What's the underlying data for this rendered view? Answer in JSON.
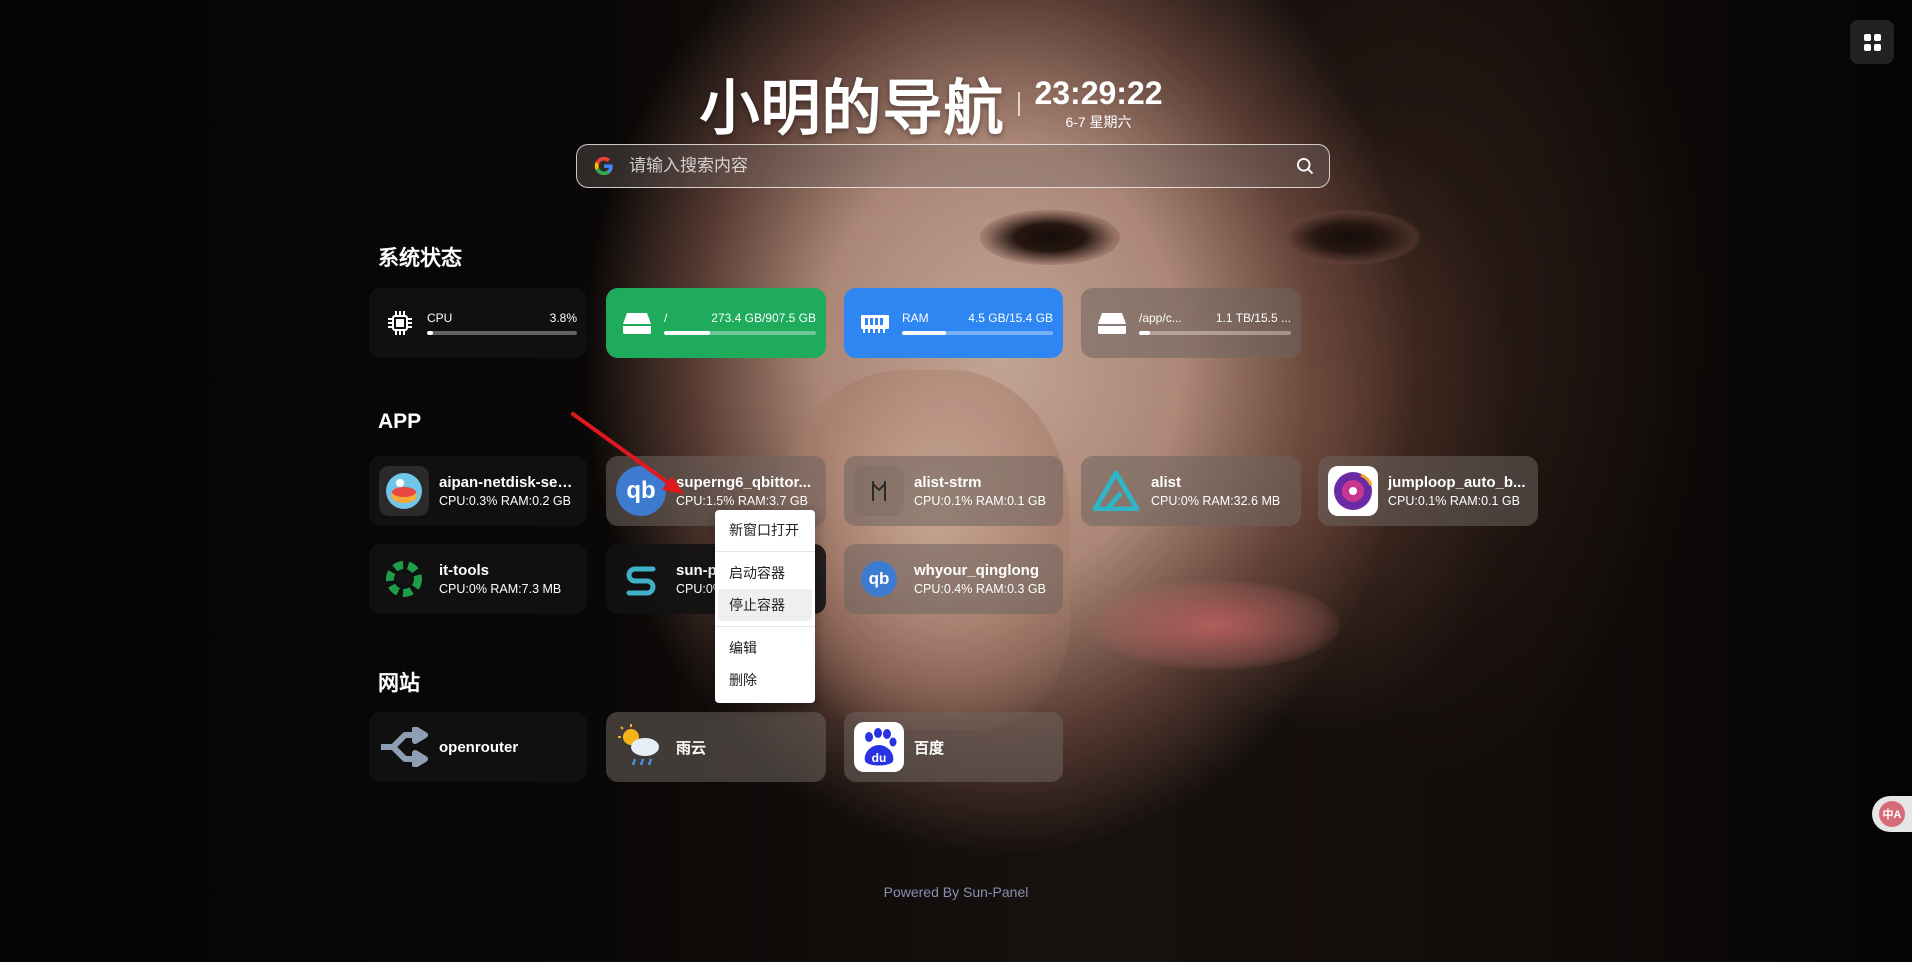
{
  "header": {
    "title": "小明的导航",
    "time": "23:29:22",
    "date": "6-7 星期六"
  },
  "search": {
    "placeholder": "请输入搜索内容"
  },
  "sections": {
    "system": "系统状态",
    "app": "APP",
    "site": "网站"
  },
  "system_status": [
    {
      "label": "CPU",
      "value": "3.8%",
      "fraction": 0.038,
      "icon": "cpu-icon",
      "color": "dark"
    },
    {
      "label": "/",
      "value": "273.4 GB/907.5 GB",
      "fraction": 0.3,
      "icon": "disk-icon",
      "color": "#1eab5b"
    },
    {
      "label": "RAM",
      "value": "4.5 GB/15.4 GB",
      "fraction": 0.29,
      "icon": "ram-icon",
      "color": "#2d86f2"
    },
    {
      "label": "/app/c...",
      "value": "1.1 TB/15.5 ...",
      "fraction": 0.07,
      "icon": "disk-icon",
      "color": "transparent"
    }
  ],
  "apps": [
    {
      "name": "aipan-netdisk-sea...",
      "meta": "CPU:0.3% RAM:0.2 GB",
      "icon": "aipan-icon"
    },
    {
      "name": "superng6_qbittor...",
      "meta": "CPU:1.5% RAM:3.7 GB",
      "icon": "qbittorrent-icon"
    },
    {
      "name": "alist-strm",
      "meta": "CPU:0.1% RAM:0.1 GB",
      "icon": "alist-strm-icon"
    },
    {
      "name": "alist",
      "meta": "CPU:0% RAM:32.6 MB",
      "icon": "alist-icon"
    },
    {
      "name": "jumploop_auto_b...",
      "meta": "CPU:0.1% RAM:0.1 GB",
      "icon": "jumploop-icon"
    },
    {
      "name": "it-tools",
      "meta": "CPU:0% RAM:7.3 MB",
      "icon": "it-tools-icon"
    },
    {
      "name": "sun-p",
      "meta": "CPU:0%",
      "icon": "sun-panel-icon"
    },
    {
      "name": "whyour_qinglong",
      "meta": "CPU:0.4% RAM:0.3 GB",
      "icon": "qinglong-icon"
    }
  ],
  "sites": [
    {
      "name": "openrouter",
      "icon": "openrouter-icon"
    },
    {
      "name": "雨云",
      "icon": "rainyun-icon"
    },
    {
      "name": "百度",
      "icon": "baidu-icon"
    }
  ],
  "context_menu": {
    "items": [
      "新窗口打开",
      "启动容器",
      "停止容器",
      "编辑",
      "删除"
    ]
  },
  "footer": "Powered By Sun-Panel",
  "translate_badge": "中A"
}
